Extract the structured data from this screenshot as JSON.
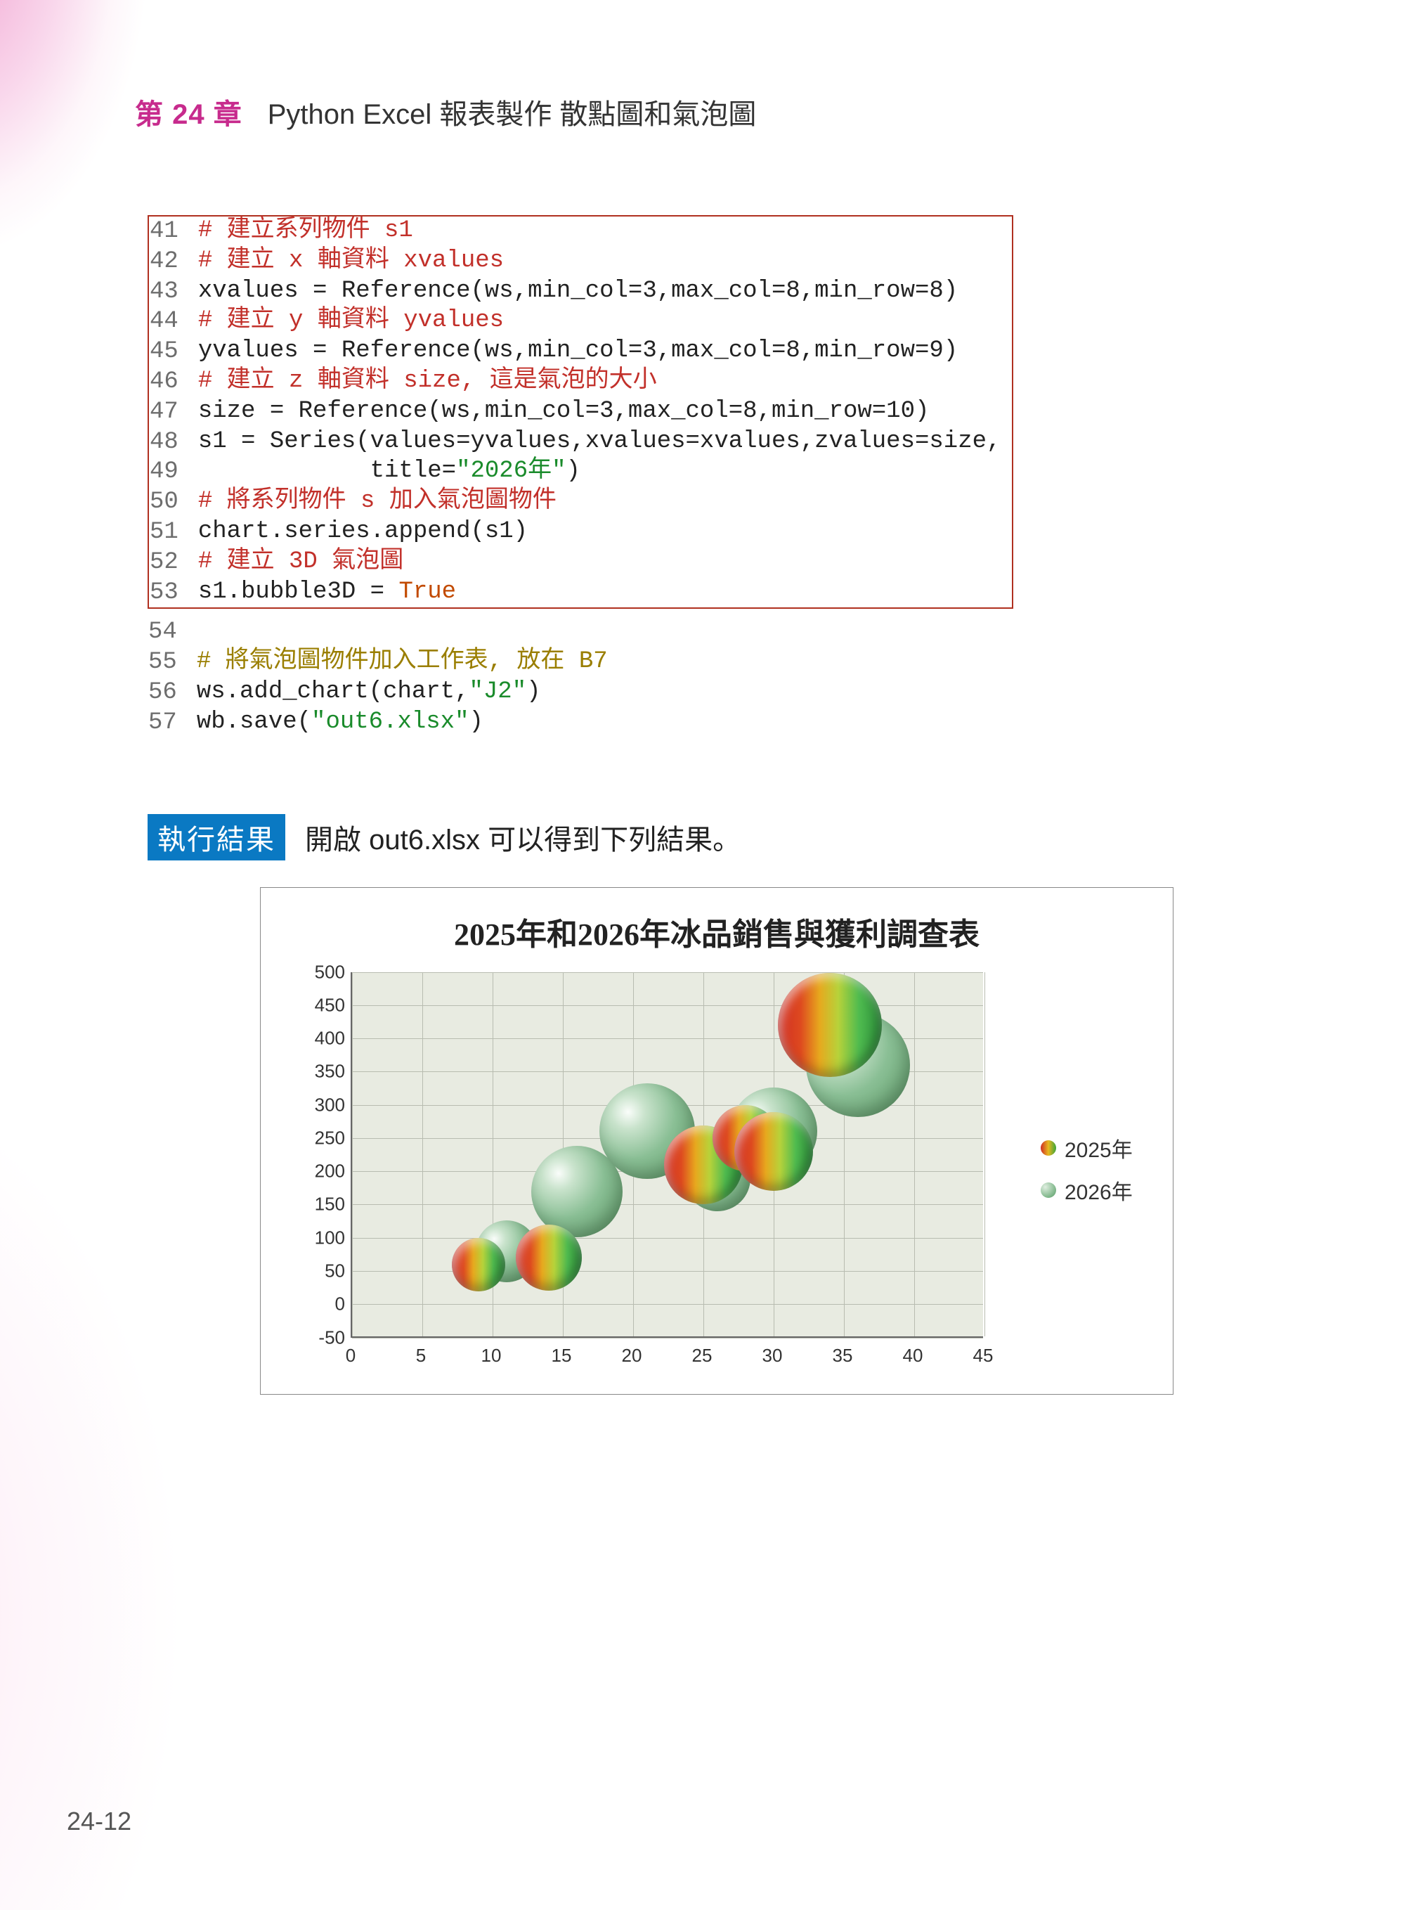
{
  "chapter": {
    "prefix": "第 ",
    "num": "24",
    "suffix": " 章",
    "title": "Python Excel 報表製作 散點圖和氣泡圖"
  },
  "code_boxed": [
    {
      "n": "41",
      "spans": [
        {
          "c": "cmtR",
          "t": "# 建立系列物件 s1"
        }
      ]
    },
    {
      "n": "42",
      "spans": [
        {
          "c": "cmtR",
          "t": "# 建立 x 軸資料 xvalues"
        }
      ]
    },
    {
      "n": "43",
      "spans": [
        {
          "c": "id",
          "t": "xvalues = Reference(ws,min_col=3,max_col=8,min_row=8)"
        }
      ]
    },
    {
      "n": "44",
      "spans": [
        {
          "c": "cmtR",
          "t": "# 建立 y 軸資料 yvalues"
        }
      ]
    },
    {
      "n": "45",
      "spans": [
        {
          "c": "id",
          "t": "yvalues = Reference(ws,min_col=3,max_col=8,min_row=9)"
        }
      ]
    },
    {
      "n": "46",
      "spans": [
        {
          "c": "cmtR",
          "t": "# 建立 z 軸資料 size, 這是氣泡的大小"
        }
      ]
    },
    {
      "n": "47",
      "spans": [
        {
          "c": "id",
          "t": "size = Reference(ws,min_col=3,max_col=8,min_row=10)"
        }
      ]
    },
    {
      "n": "48",
      "spans": [
        {
          "c": "id",
          "t": "s1 = Series(values=yvalues,xvalues=xvalues,zvalues=size,"
        }
      ]
    },
    {
      "n": "49",
      "spans": [
        {
          "c": "id",
          "t": "            title="
        },
        {
          "c": "str",
          "t": "\"2026年\""
        },
        {
          "c": "id",
          "t": ")"
        }
      ]
    },
    {
      "n": "50",
      "spans": [
        {
          "c": "cmtR",
          "t": "# 將系列物件 s 加入氣泡圖物件"
        }
      ]
    },
    {
      "n": "51",
      "spans": [
        {
          "c": "id",
          "t": "chart.series.append(s1)"
        }
      ]
    },
    {
      "n": "52",
      "spans": [
        {
          "c": "cmtR",
          "t": "# 建立 3D 氣泡圖"
        }
      ]
    },
    {
      "n": "53",
      "spans": [
        {
          "c": "id",
          "t": "s1.bubble3D = "
        },
        {
          "c": "kw",
          "t": "True"
        }
      ]
    }
  ],
  "code_after": [
    {
      "n": "54",
      "spans": []
    },
    {
      "n": "55",
      "spans": [
        {
          "c": "cmt",
          "t": "# 將氣泡圖物件加入工作表, 放在 B7"
        }
      ]
    },
    {
      "n": "56",
      "spans": [
        {
          "c": "id",
          "t": "ws.add_chart(chart,"
        },
        {
          "c": "str",
          "t": "\"J2\""
        },
        {
          "c": "id",
          "t": ")"
        }
      ]
    },
    {
      "n": "57",
      "spans": [
        {
          "c": "id",
          "t": "wb.save("
        },
        {
          "c": "str",
          "t": "\"out6.xlsx\""
        },
        {
          "c": "id",
          "t": ")"
        }
      ]
    }
  ],
  "result": {
    "badge": "執行結果",
    "text": "開啟 out6.xlsx 可以得到下列結果。"
  },
  "chart_data": {
    "type": "bubble",
    "title": "2025年和2026年冰品銷售與獲利調查表",
    "xlabel": "",
    "ylabel": "",
    "xlim": [
      0,
      45
    ],
    "ylim": [
      -50,
      500
    ],
    "xticks": [
      0,
      5,
      10,
      15,
      20,
      25,
      30,
      35,
      40,
      45
    ],
    "yticks": [
      -50,
      0,
      50,
      100,
      150,
      200,
      250,
      300,
      350,
      400,
      450,
      500
    ],
    "series": [
      {
        "name": "2025年",
        "points": [
          {
            "x": 9,
            "y": 60,
            "size": 40
          },
          {
            "x": 14,
            "y": 70,
            "size": 55
          },
          {
            "x": 25,
            "y": 210,
            "size": 70
          },
          {
            "x": 28,
            "y": 250,
            "size": 55
          },
          {
            "x": 30,
            "y": 230,
            "size": 70
          },
          {
            "x": 34,
            "y": 420,
            "size": 100
          }
        ]
      },
      {
        "name": "2026年",
        "points": [
          {
            "x": 11,
            "y": 80,
            "size": 50
          },
          {
            "x": 16,
            "y": 170,
            "size": 85
          },
          {
            "x": 21,
            "y": 260,
            "size": 90
          },
          {
            "x": 26,
            "y": 190,
            "size": 55
          },
          {
            "x": 30,
            "y": 260,
            "size": 80
          },
          {
            "x": 36,
            "y": 360,
            "size": 100
          }
        ]
      }
    ],
    "legend": [
      "2025年",
      "2026年"
    ]
  },
  "page_number": "24-12"
}
